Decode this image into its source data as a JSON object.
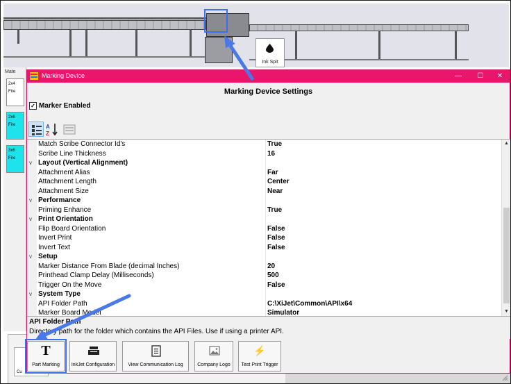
{
  "scene": {
    "ink_spit_label": "Ink Spit",
    "ink_drop_icon": "drop-icon"
  },
  "left_panel": {
    "tab": "Mate",
    "cards": [
      {
        "line1": "2x4",
        "line2": "Fire",
        "style": "white"
      },
      {
        "line1": "2x6",
        "line2": "Fire",
        "style": "cyan"
      },
      {
        "line1": "3x6",
        "line2": "Fire",
        "style": "cyan"
      }
    ],
    "behind_button": "Cu"
  },
  "dialog": {
    "title": "Marking Device",
    "window_controls": {
      "minimize": "—",
      "maximize": "☐",
      "close": "✕"
    },
    "heading": "Marking Device Settings",
    "marker_enabled_label": "Marker Enabled",
    "marker_enabled_checked": "✓",
    "toolbar_icons": [
      "categorized-icon",
      "alphabetical-sort-icon",
      "property-pages-icon"
    ],
    "property_rows": [
      {
        "kind": "prop",
        "name": "Match Scribe Connector Id's",
        "value": "True"
      },
      {
        "kind": "prop",
        "name": "Scribe Line Thickness",
        "value": "16"
      },
      {
        "kind": "cat",
        "name": "Layout (Vertical Alignment)",
        "chevron": "v"
      },
      {
        "kind": "prop",
        "name": "Attachment Alias",
        "value": "Far"
      },
      {
        "kind": "prop",
        "name": "Attachment Length",
        "value": "Center"
      },
      {
        "kind": "prop",
        "name": "Attachment Size",
        "value": "Near"
      },
      {
        "kind": "cat",
        "name": "Performance",
        "chevron": "v"
      },
      {
        "kind": "prop",
        "name": "Priming Enhance",
        "value": "True"
      },
      {
        "kind": "cat",
        "name": "Print Orientation",
        "chevron": "v"
      },
      {
        "kind": "prop",
        "name": "Flip Board Orientation",
        "value": "False"
      },
      {
        "kind": "prop",
        "name": "Invert Print",
        "value": "False"
      },
      {
        "kind": "prop",
        "name": "Invert Text",
        "value": "False"
      },
      {
        "kind": "cat",
        "name": "Setup",
        "chevron": "v"
      },
      {
        "kind": "prop",
        "name": "Marker Distance From Blade (decimal Inches)",
        "value": "20"
      },
      {
        "kind": "prop",
        "name": "Printhead Clamp Delay (Milliseconds)",
        "value": "500"
      },
      {
        "kind": "prop",
        "name": "Trigger On the Move",
        "value": "False"
      },
      {
        "kind": "cat",
        "name": "System Type",
        "chevron": "v"
      },
      {
        "kind": "prop",
        "name": "API Folder Path",
        "value": "C:\\XiJet\\Common\\API\\x64"
      },
      {
        "kind": "prop",
        "name": "Marker Board Model",
        "value": "Simulator"
      }
    ],
    "description_title": "API Folder Path",
    "description_text": "Directory path for the folder which contains the API Files.  Use if using a printer API."
  },
  "buttons": [
    {
      "label": "Part Marking",
      "icon": "text-t-icon",
      "glyph": "T"
    },
    {
      "label": "InkJet Configuration",
      "icon": "printer-icon",
      "glyph": ""
    },
    {
      "label": "View Communication Log",
      "icon": "document-icon",
      "glyph": ""
    },
    {
      "label": "Company Logo",
      "icon": "image-icon",
      "glyph": ""
    },
    {
      "label": "Test Print Trigger",
      "icon": "lightning-icon",
      "glyph": "⚡"
    }
  ],
  "colors": {
    "titlebar": "#e8176b",
    "highlight": "#3f6df0",
    "cyan_card": "#1fe3ea"
  }
}
